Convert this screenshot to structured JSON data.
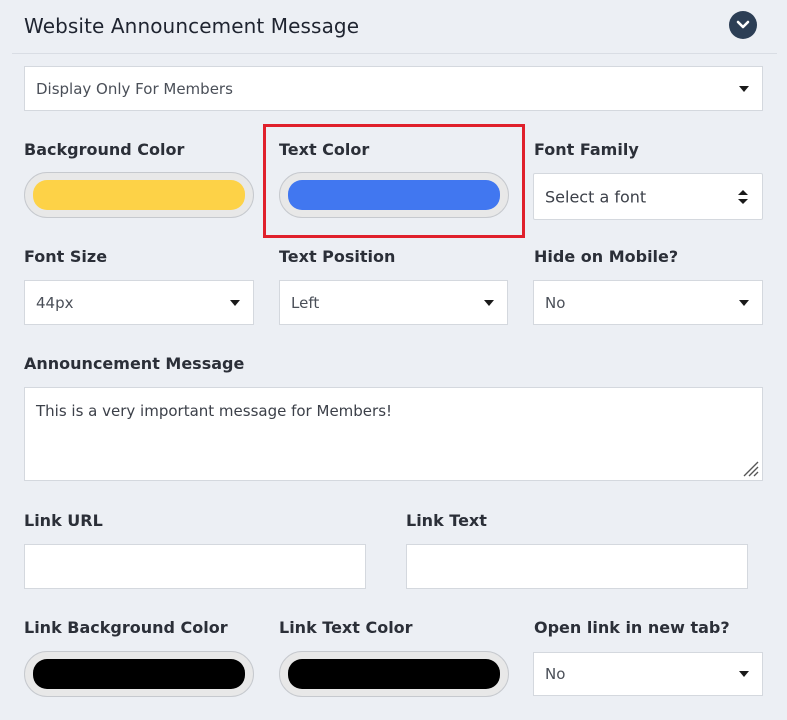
{
  "header": {
    "title": "Website Announcement Message"
  },
  "display_select": {
    "value": "Display Only For Members"
  },
  "colors": {
    "background": "#fdd247",
    "text": "#4177f0",
    "link_background": "#000000",
    "link_text": "#000000"
  },
  "labels": {
    "background_color": "Background Color",
    "text_color": "Text Color",
    "font_family": "Font Family",
    "font_size": "Font Size",
    "text_position": "Text Position",
    "hide_on_mobile": "Hide on Mobile?",
    "announcement_message": "Announcement Message",
    "link_url": "Link URL",
    "link_text": "Link Text",
    "link_background_color": "Link Background Color",
    "link_text_color": "Link Text Color",
    "open_new_tab": "Open link in new tab?"
  },
  "font_family_select": {
    "value": "Select a font"
  },
  "font_size_select": {
    "value": "44px"
  },
  "text_position_select": {
    "value": "Left"
  },
  "hide_mobile_select": {
    "value": "No"
  },
  "announcement": {
    "value": "This is a very important message for Members!"
  },
  "link_url_input": {
    "value": ""
  },
  "link_text_input": {
    "value": ""
  },
  "open_new_tab_select": {
    "value": "No"
  },
  "icons": {
    "collapse": "chevron-down-icon",
    "resize": "resize-grip-icon"
  }
}
